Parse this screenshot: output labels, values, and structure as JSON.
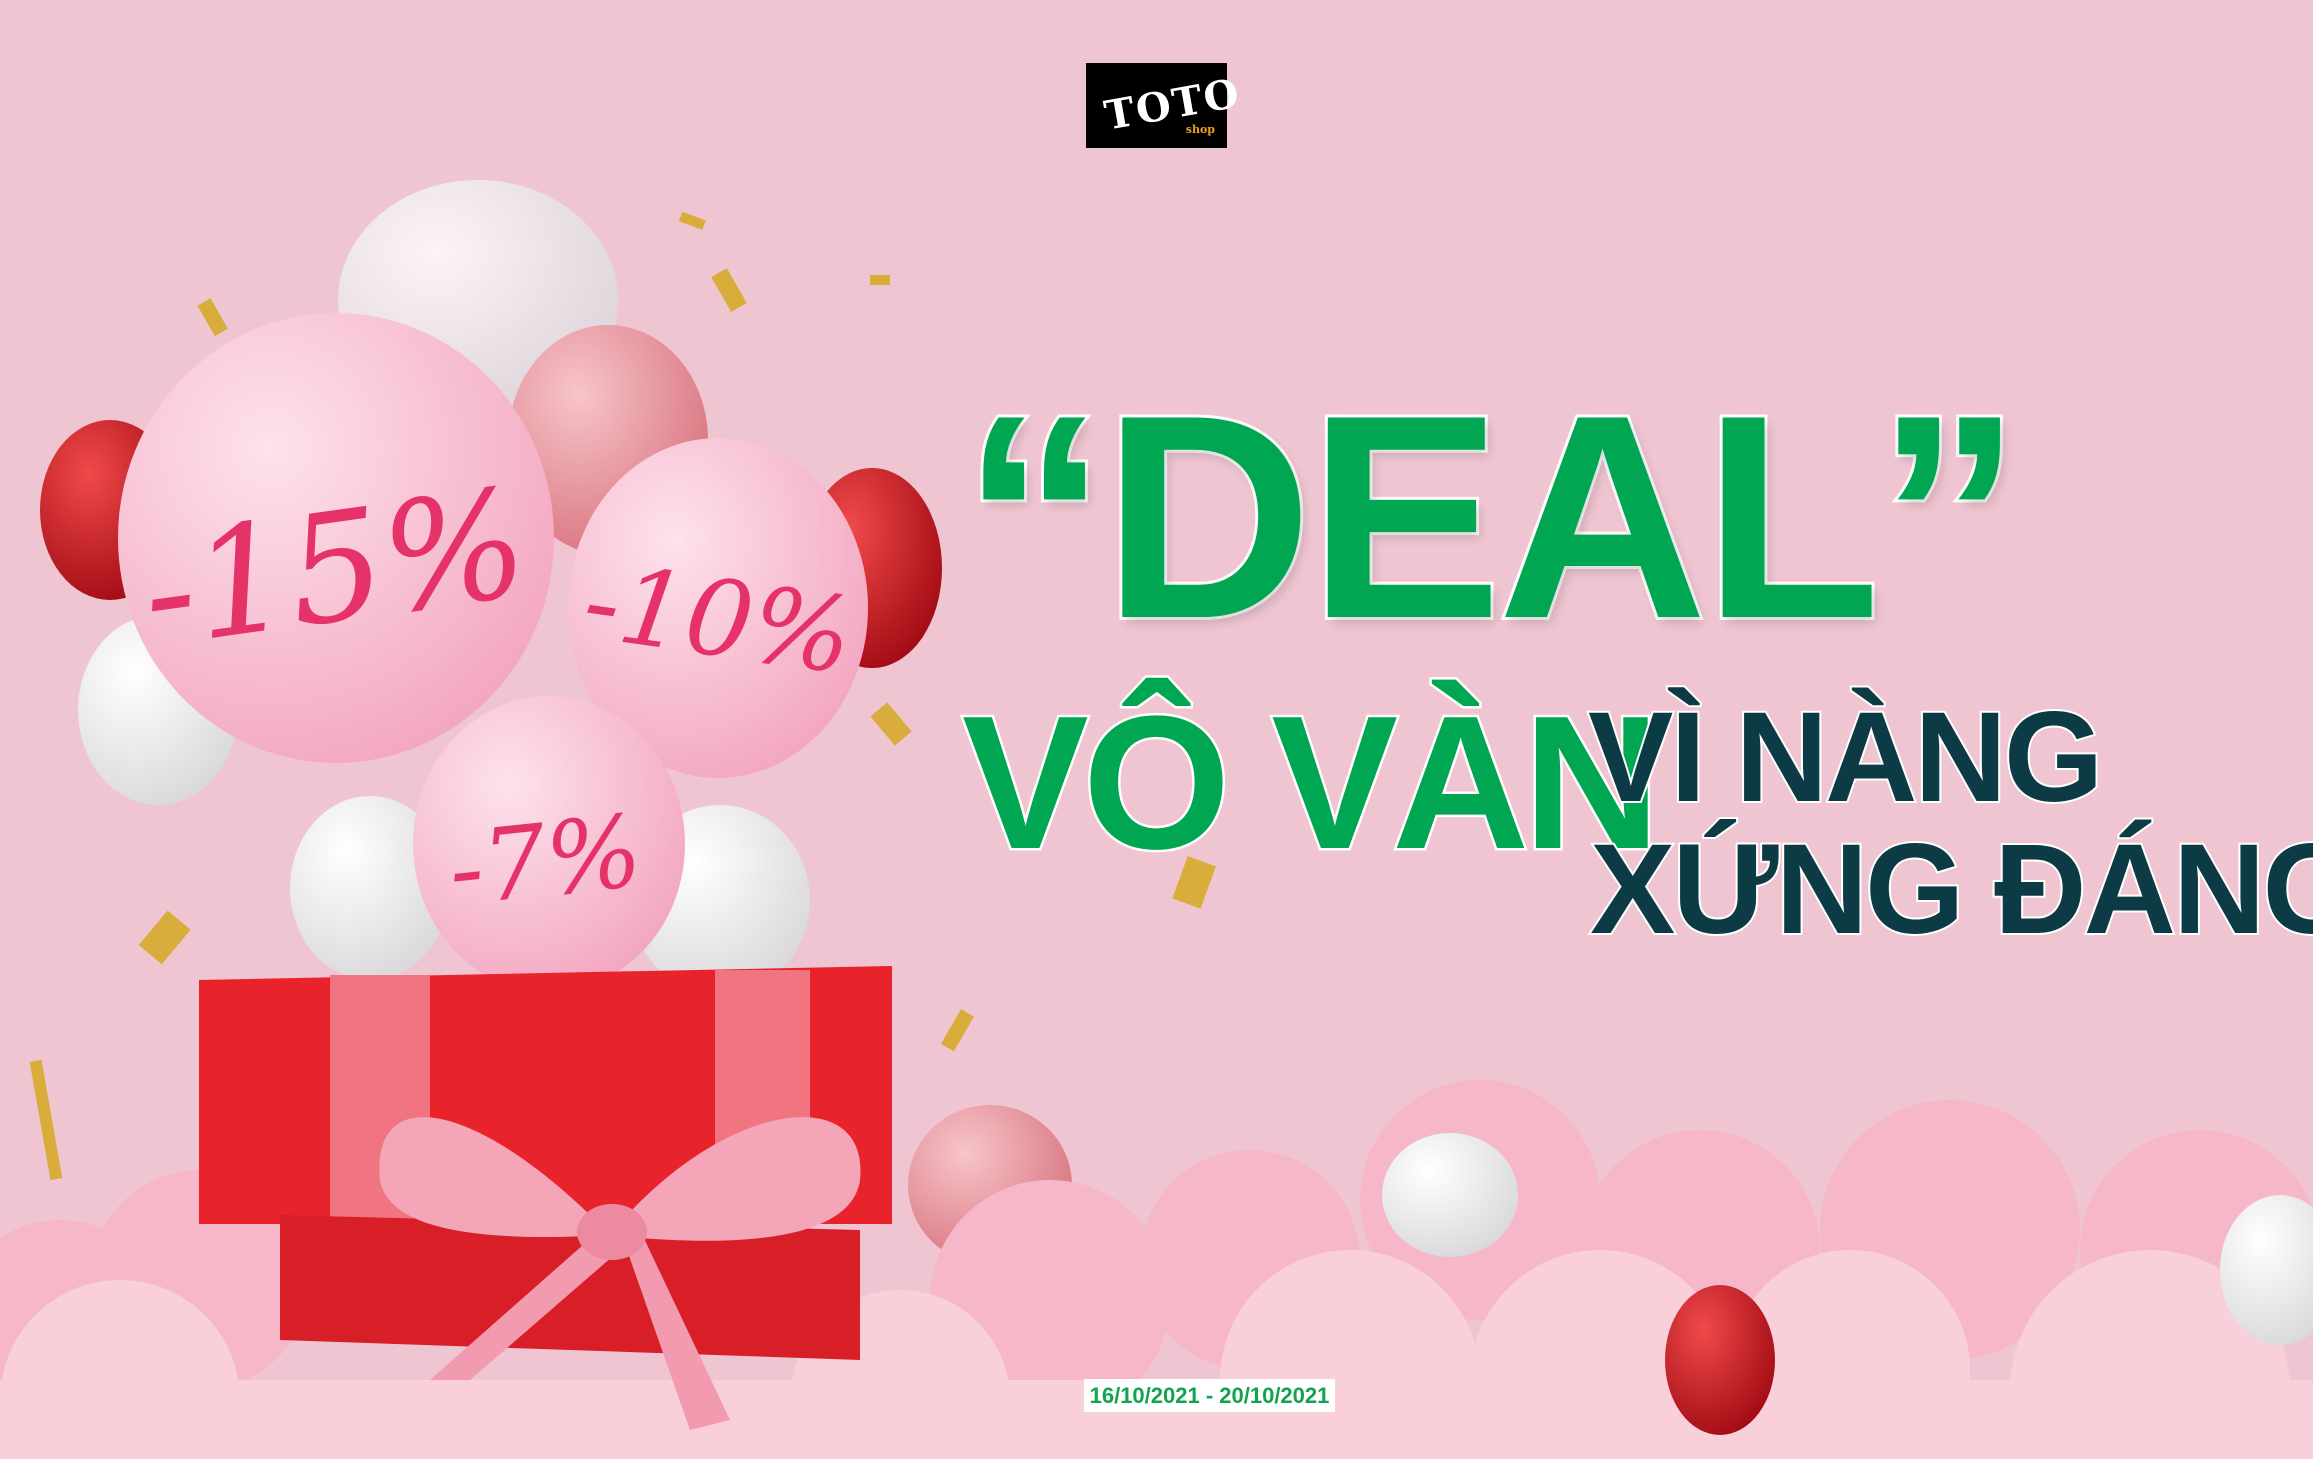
{
  "logo": {
    "name": "TOTO",
    "sub": "shop"
  },
  "headline": {
    "deal": "“DEAL”",
    "line2": "VÔ VÀN",
    "line3a": "VÌ NÀNG",
    "line3b": "XỨNG ĐÁNG"
  },
  "balloons": {
    "b1": "-15%",
    "b2": "-10%",
    "b3": "-7%"
  },
  "date_range": "16/10/2021 - 20/10/2021",
  "colors": {
    "background": "#efc5d1",
    "green": "#00a651",
    "navy": "#0d3b45",
    "box": "#e8232b"
  }
}
